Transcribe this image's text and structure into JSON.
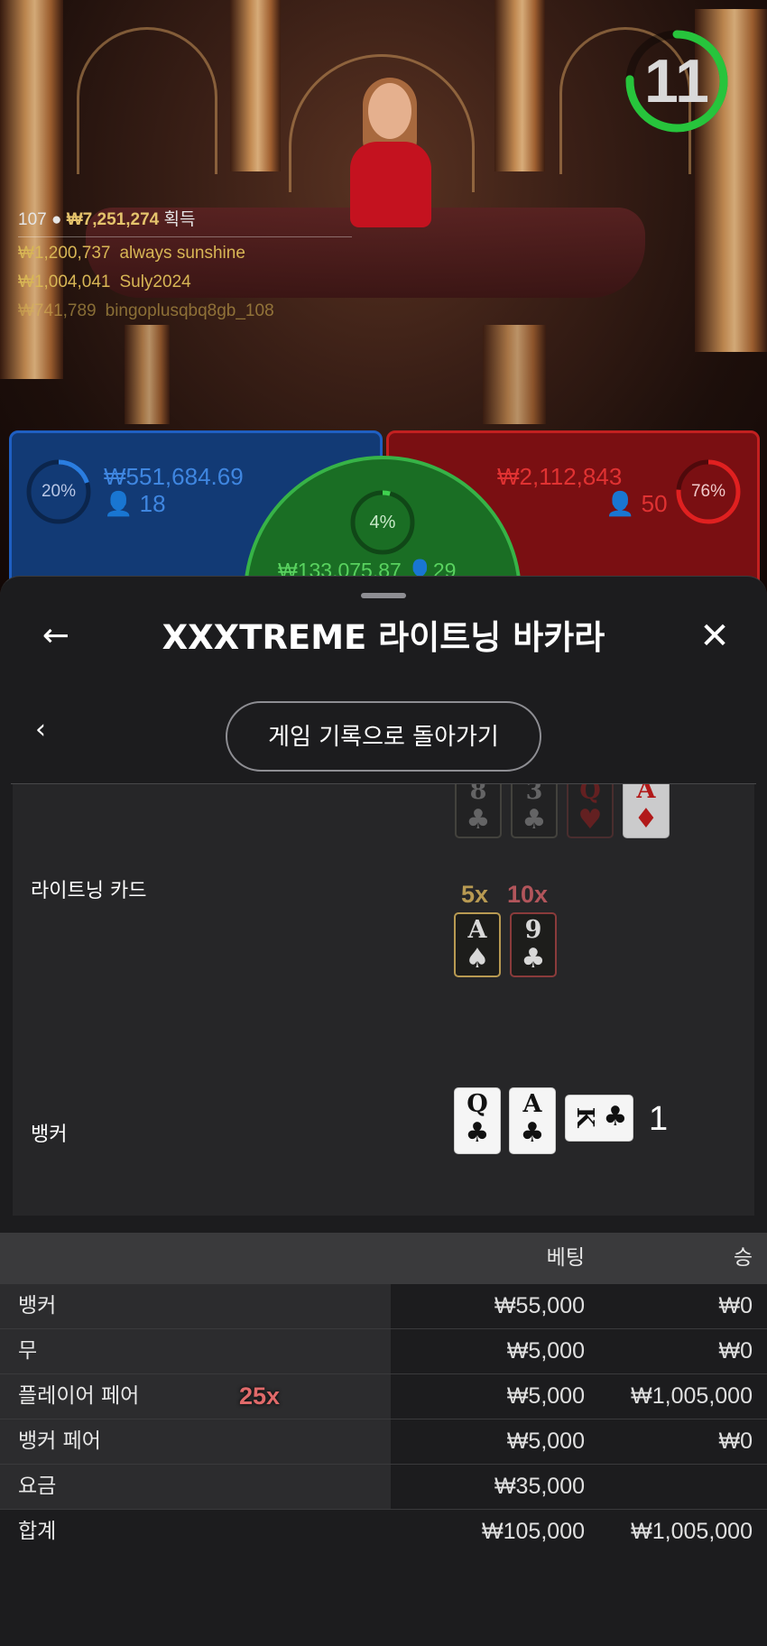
{
  "timer": {
    "seconds": "11",
    "color": "#27c43c"
  },
  "winners": {
    "count": "107",
    "total": "₩7,251,274",
    "total_suffix": "획득",
    "list": [
      {
        "amount": "₩1,200,737",
        "name": "always sunshine"
      },
      {
        "amount": "₩1,004,041",
        "name": "Suly2024"
      },
      {
        "amount": "₩741,789",
        "name": "bingoplusqbq8gb_108"
      }
    ]
  },
  "bets": {
    "player": {
      "percent": "20%",
      "amount": "₩551,684.69",
      "players": "18",
      "color": "#1f5fc2"
    },
    "tie": {
      "percent": "4%",
      "amount": "₩133,075.87",
      "players": "29",
      "color": "#37b347"
    },
    "banker": {
      "percent": "76%",
      "amount": "₩2,112,843",
      "players": "50",
      "color": "#c22020"
    }
  },
  "sheet": {
    "title": "XXXTREME 라이트닝 바카라",
    "back_pill": "게임 기록으로 돌아가기"
  },
  "round": {
    "top_cards": [
      {
        "rank": "8",
        "suit": "♣"
      },
      {
        "rank": "3",
        "suit": "♣"
      },
      {
        "rank": "Q",
        "suit": "♥"
      },
      {
        "rank": "A",
        "suit": "♦"
      }
    ],
    "lightning_label": "라이트닝 카드",
    "lightning_cards": [
      {
        "mult": "5x",
        "rank": "A",
        "suit": "♠"
      },
      {
        "mult": "10x",
        "rank": "9",
        "suit": "♣"
      }
    ],
    "banker_label": "뱅커",
    "banker_cards": [
      {
        "rank": "Q",
        "suit": "♣"
      },
      {
        "rank": "A",
        "suit": "♣"
      },
      {
        "rank": "K",
        "suit": "♣"
      }
    ],
    "banker_total": "1"
  },
  "table": {
    "headers": {
      "bet": "베팅",
      "win": "승"
    },
    "rows": [
      {
        "label": "뱅커",
        "bet": "₩55,000",
        "win": "₩0"
      },
      {
        "label": "무",
        "bet": "₩5,000",
        "win": "₩0"
      },
      {
        "label": "플레이어 페어",
        "badge": "25x",
        "bet": "₩5,000",
        "win": "₩1,005,000"
      },
      {
        "label": "뱅커 페어",
        "bet": "₩5,000",
        "win": "₩0"
      },
      {
        "label": "요금",
        "bet": "₩35,000",
        "win": ""
      }
    ],
    "total": {
      "label": "합계",
      "bet": "₩105,000",
      "win": "₩1,005,000"
    }
  }
}
